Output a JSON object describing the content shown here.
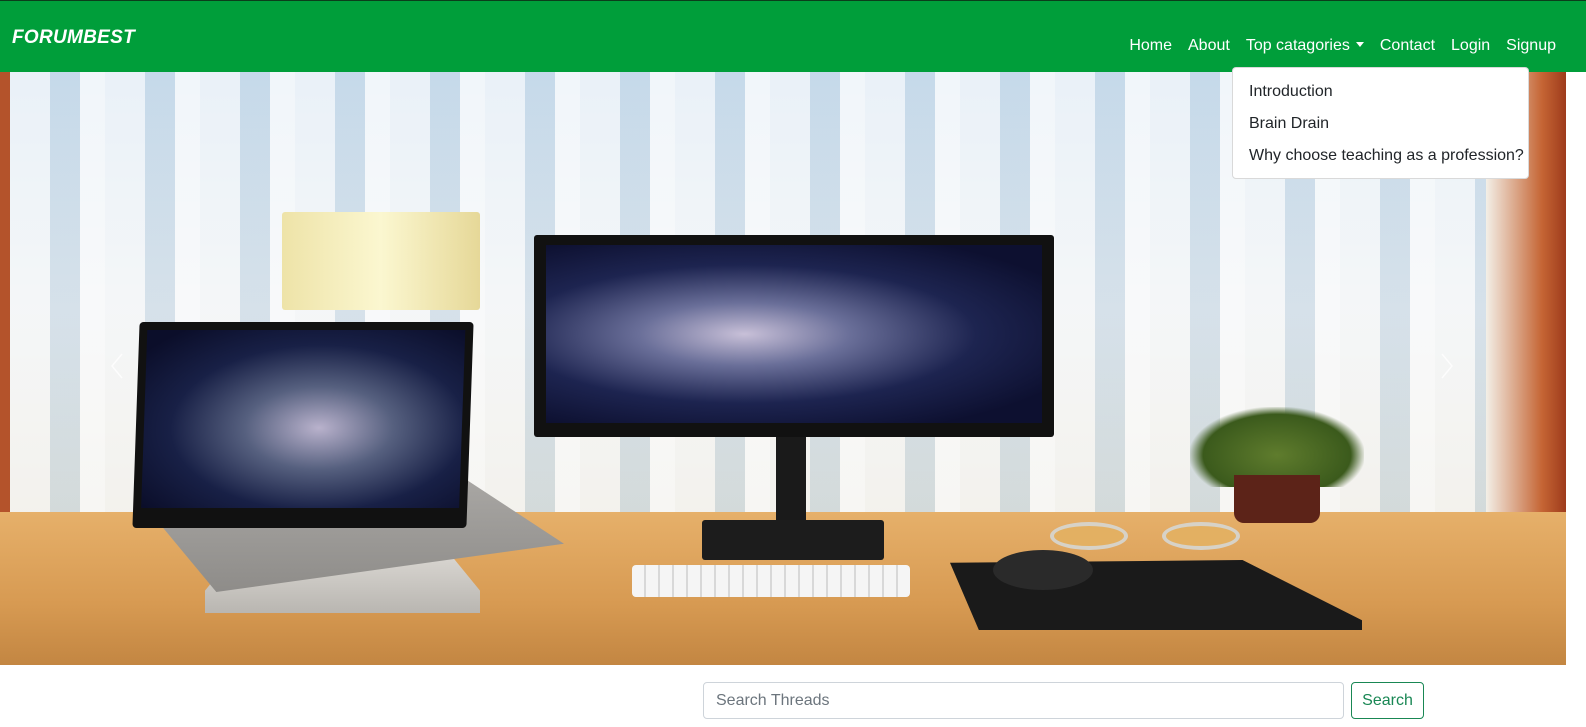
{
  "brand": {
    "name": "FORUMBEST"
  },
  "nav": {
    "items": [
      {
        "label": "Home"
      },
      {
        "label": "About"
      },
      {
        "label": "Top catagories"
      },
      {
        "label": "Contact"
      },
      {
        "label": "Login"
      },
      {
        "label": "Signup"
      }
    ]
  },
  "dropdown": {
    "items": [
      {
        "label": "Introduction"
      },
      {
        "label": "Brain Drain"
      },
      {
        "label": "Why choose teaching as a profession?"
      }
    ]
  },
  "hero": {
    "alt": "desk setup with laptop and monitor"
  },
  "search": {
    "placeholder": "Search Threads",
    "button_label": "Search"
  },
  "colors": {
    "navbar": "#009e3a",
    "search_button": "#198754"
  },
  "icons": {
    "prev": "chevron-left-icon",
    "next": "chevron-right-icon",
    "dropdown": "caret-down-icon"
  }
}
